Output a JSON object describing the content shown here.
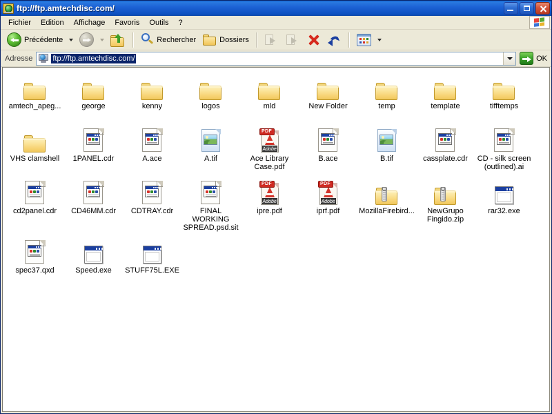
{
  "window": {
    "title": "ftp://ftp.amtechdisc.com/",
    "icon": "ftp-globe-icon",
    "buttons": {
      "minimize": "Minimize",
      "maximize": "Maximize",
      "close": "Close"
    }
  },
  "menu": {
    "items": [
      {
        "label": "Fichier"
      },
      {
        "label": "Edition"
      },
      {
        "label": "Affichage"
      },
      {
        "label": "Favoris"
      },
      {
        "label": "Outils"
      },
      {
        "label": "?"
      }
    ],
    "flag_button": "windows-flag-button"
  },
  "toolbar": {
    "back_label": "Précédente",
    "forward_label": "",
    "up_label": "",
    "search_label": "Rechercher",
    "folders_label": "Dossiers",
    "move_to_label": "",
    "delete_label": "",
    "undo_label": "",
    "views_label": ""
  },
  "address": {
    "label": "Adresse",
    "value": "ftp://ftp.amtechdisc.com/",
    "go_label": "OK"
  },
  "content": {
    "items": [
      {
        "name": "amtech_apeg...",
        "type": "folder"
      },
      {
        "name": "george",
        "type": "folder"
      },
      {
        "name": "kenny",
        "type": "folder"
      },
      {
        "name": "logos",
        "type": "folder"
      },
      {
        "name": "mld",
        "type": "folder"
      },
      {
        "name": "New Folder",
        "type": "folder"
      },
      {
        "name": "temp",
        "type": "folder"
      },
      {
        "name": "template",
        "type": "folder"
      },
      {
        "name": "tifftemps",
        "type": "folder"
      },
      {
        "name": "VHS clamshell",
        "type": "folder"
      },
      {
        "name": "1PANEL.cdr",
        "type": "doc"
      },
      {
        "name": "A.ace",
        "type": "doc"
      },
      {
        "name": "A.tif",
        "type": "image"
      },
      {
        "name": "Ace Library Case.pdf",
        "type": "pdf"
      },
      {
        "name": "B.ace",
        "type": "doc"
      },
      {
        "name": "B.tif",
        "type": "image"
      },
      {
        "name": "cassplate.cdr",
        "type": "doc"
      },
      {
        "name": "CD - silk screen (outlined).ai",
        "type": "doc"
      },
      {
        "name": "cd2panel.cdr",
        "type": "doc"
      },
      {
        "name": "CD46MM.cdr",
        "type": "doc"
      },
      {
        "name": "CDTRAY.cdr",
        "type": "doc"
      },
      {
        "name": "FINAL WORKING SPREAD.psd.sit",
        "type": "doc"
      },
      {
        "name": "ipre.pdf",
        "type": "pdf"
      },
      {
        "name": "iprf.pdf",
        "type": "pdf"
      },
      {
        "name": "MozillaFirebird...",
        "type": "zip"
      },
      {
        "name": "NewGrupo Fingido.zip",
        "type": "zip"
      },
      {
        "name": "rar32.exe",
        "type": "exe"
      },
      {
        "name": "spec37.qxd",
        "type": "doc"
      },
      {
        "name": "Speed.exe",
        "type": "exe"
      },
      {
        "name": "STUFF75L.EXE",
        "type": "exe"
      }
    ]
  },
  "colors": {
    "titlebar": "#0d50c0",
    "chrome": "#ece9d8",
    "selection": "#0a246a",
    "accent_green": "#3da32a",
    "pdf_red": "#cf2a22"
  }
}
